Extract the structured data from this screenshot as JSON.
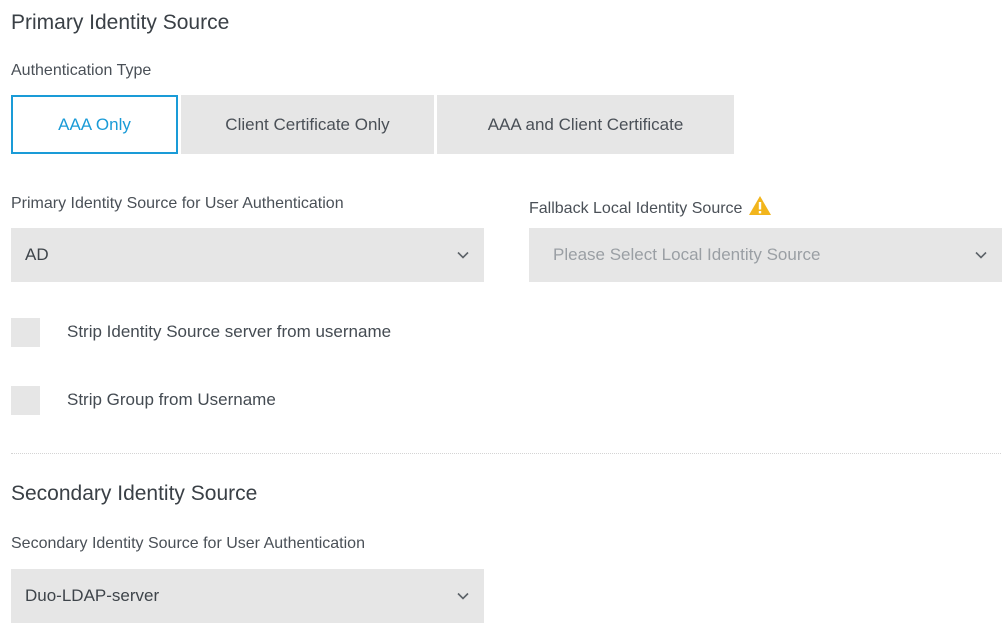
{
  "primary": {
    "title": "Primary Identity Source",
    "auth_type_label": "Authentication Type",
    "auth_types": [
      {
        "label": "AAA Only",
        "active": true
      },
      {
        "label": "Client Certificate Only",
        "active": false
      },
      {
        "label": "AAA and Client Certificate",
        "active": false
      }
    ],
    "source_label": "Primary Identity Source for User Authentication",
    "source_value": "AD",
    "fallback_label": "Fallback Local Identity Source",
    "fallback_placeholder": "Please Select Local Identity Source",
    "strip_source_label": "Strip Identity Source server from username",
    "strip_group_label": "Strip Group from Username"
  },
  "secondary": {
    "title": "Secondary Identity Source",
    "source_label": "Secondary Identity Source for User Authentication",
    "source_value": "Duo-LDAP-server"
  },
  "icons": {
    "chevron": "chevron-down-icon",
    "warning": "warning-icon"
  },
  "colors": {
    "accent": "#1a9bd7",
    "control_bg": "#e6e6e6",
    "warning": "#f2b51c"
  }
}
